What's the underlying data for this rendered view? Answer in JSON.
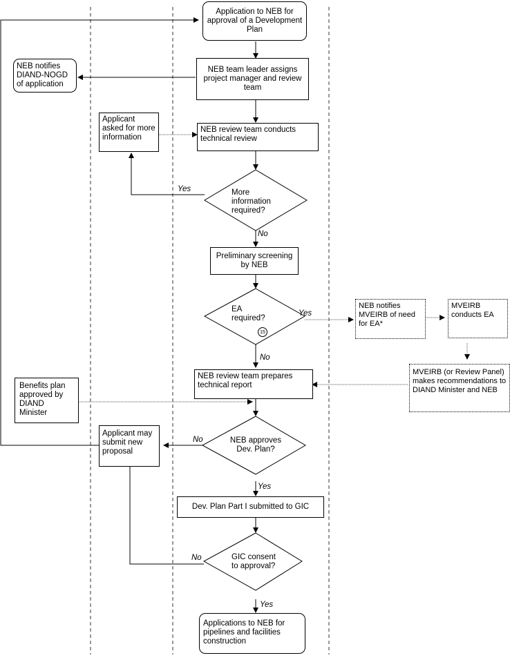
{
  "diagram": {
    "type": "flowchart",
    "swimlane_dividers": 4,
    "nodes": {
      "application": "Application to NEB for approval of a Development Plan",
      "notify_diand": "NEB notifies DIAND-NOGD of application",
      "assign_team": "NEB team leader assigns project manager and review team",
      "applicant_more_info": "Applicant asked for more information",
      "technical_review": "NEB review team conducts technical review",
      "more_info_decision": "More information required?",
      "preliminary_screening": "Preliminary screening by NEB",
      "ea_decision": "EA required?",
      "ea_ref": "15",
      "notify_mveirb": "NEB notifies MVEIRB of need for EA*",
      "mveirb_conducts": "MVEIRB conducts EA",
      "mveirb_recommends": "MVEIRB (or Review Panel) makes recommendations to DIAND  Minister and NEB",
      "technical_report": "NEB review team prepares technical report",
      "benefits_plan": "Benefits plan approved by DIAND Minister",
      "neb_approves_decision": "NEB approves Dev. Plan?",
      "new_proposal": "Applicant may submit  new proposal",
      "submitted_gic": "Dev. Plan Part I submitted to GIC",
      "gic_decision": "GIC consent to approval?",
      "final_applications": "Applications to NEB for pipelines and facilities construction"
    },
    "edge_labels": {
      "yes": "Yes",
      "no": "No"
    }
  }
}
